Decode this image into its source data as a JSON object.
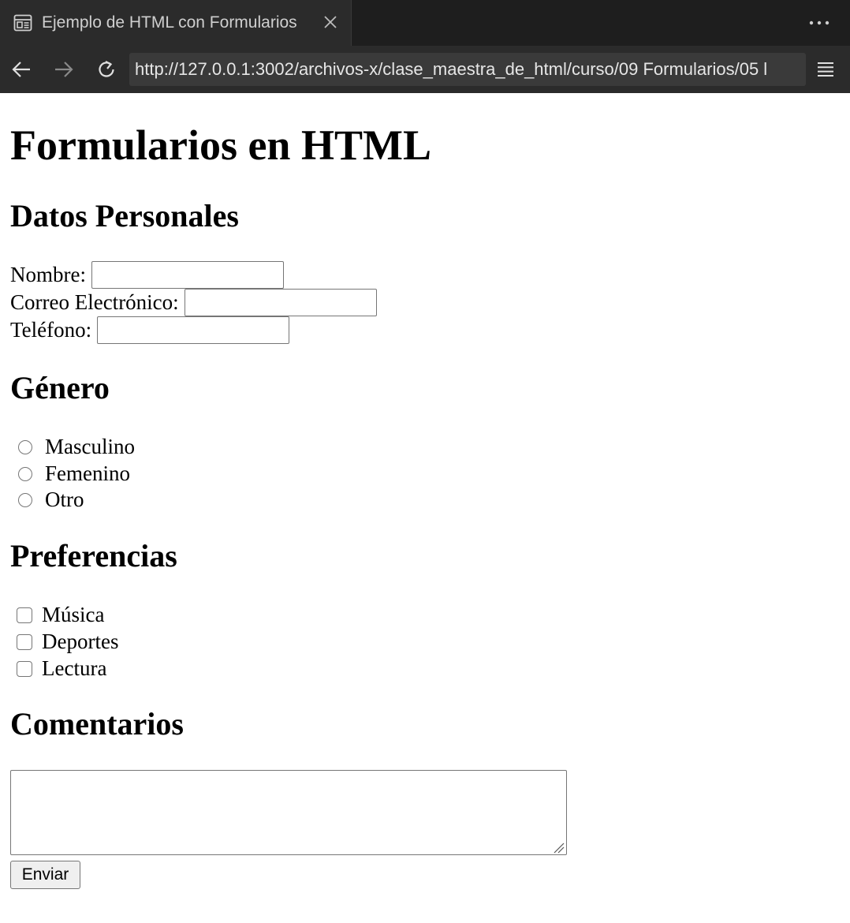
{
  "browser": {
    "tab_title": "Ejemplo de HTML con Formularios",
    "url": "http://127.0.0.1:3002/archivos-x/clase_maestra_de_html/curso/09 Formularios/05 l"
  },
  "page": {
    "title": "Formularios en HTML",
    "personal": {
      "heading": "Datos Personales",
      "name_label": "Nombre:",
      "email_label": "Correo Electrónico:",
      "phone_label": "Teléfono:"
    },
    "gender": {
      "heading": "Género",
      "options": [
        "Masculino",
        "Femenino",
        "Otro"
      ]
    },
    "preferences": {
      "heading": "Preferencias",
      "options": [
        "Música",
        "Deportes",
        "Lectura"
      ]
    },
    "comments": {
      "heading": "Comentarios"
    },
    "submit_label": "Enviar"
  },
  "colors": {
    "chrome_dark": "#1e1e1e",
    "chrome_bar": "#2b2b2b",
    "url_bg": "#3a3a3a"
  },
  "icons": [
    "page-icon",
    "close-icon",
    "more-icon",
    "back-icon",
    "forward-icon",
    "reload-icon",
    "menu-icon"
  ]
}
